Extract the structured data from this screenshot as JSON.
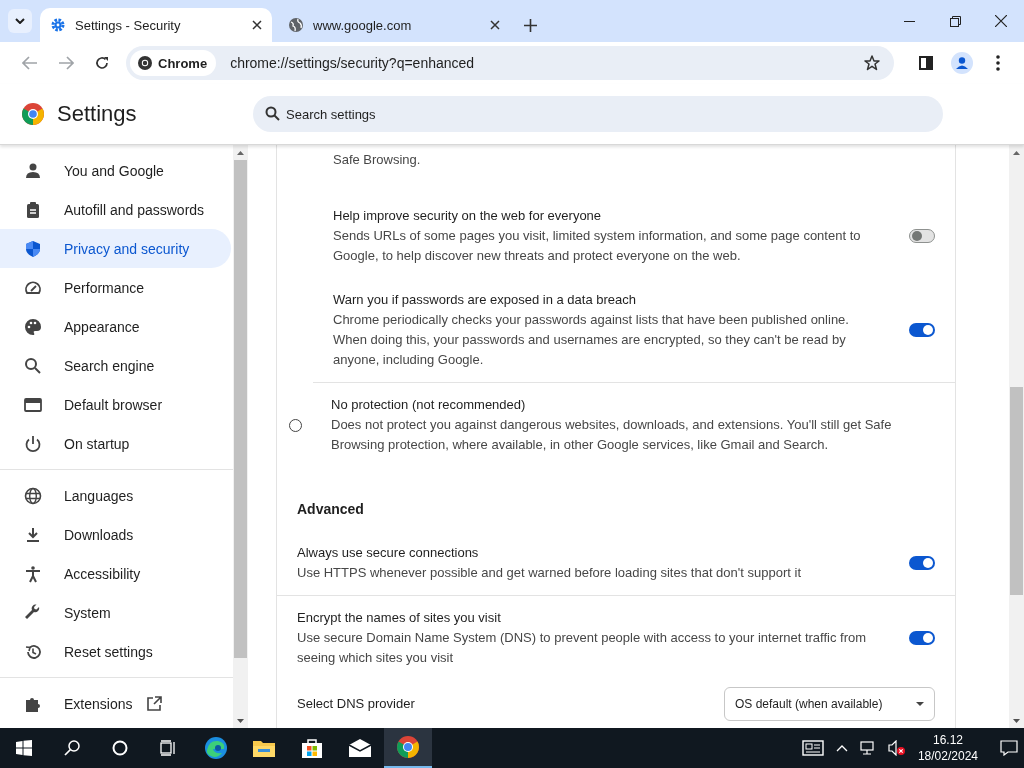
{
  "tabs": [
    {
      "title": "Settings - Security",
      "selected": true
    },
    {
      "title": "www.google.com",
      "selected": false
    }
  ],
  "toolbar": {
    "site_chip": "Chrome",
    "url": "chrome://settings/security?q=enhanced"
  },
  "header": {
    "title": "Settings",
    "search_placeholder": "Search settings"
  },
  "sidebar": {
    "groups": [
      [
        {
          "label": "You and Google",
          "selected": false
        },
        {
          "label": "Autofill and passwords",
          "selected": false
        },
        {
          "label": "Privacy and security",
          "selected": true
        },
        {
          "label": "Performance",
          "selected": false
        },
        {
          "label": "Appearance",
          "selected": false
        },
        {
          "label": "Search engine",
          "selected": false
        },
        {
          "label": "Default browser",
          "selected": false
        },
        {
          "label": "On startup",
          "selected": false
        }
      ],
      [
        {
          "label": "Languages",
          "selected": false
        },
        {
          "label": "Downloads",
          "selected": false
        },
        {
          "label": "Accessibility",
          "selected": false
        },
        {
          "label": "System",
          "selected": false
        },
        {
          "label": "Reset settings",
          "selected": false
        }
      ],
      [
        {
          "label": "Extensions",
          "selected": false,
          "external": true
        }
      ]
    ]
  },
  "content": {
    "rows": [
      {
        "kind": "note",
        "text": "Safe Browsing.",
        "separated": false
      },
      {
        "kind": "sub_toggle",
        "title": "Help improve security on the web for everyone",
        "description": "Sends URLs of some pages you visit, limited system information, and some page content to Google, to help discover new threats and protect everyone on the web.",
        "on": false,
        "separated": false
      },
      {
        "kind": "sub_toggle",
        "title": "Warn you if passwords are exposed in a data breach",
        "description": "Chrome periodically checks your passwords against lists that have been published online. When doing this, your passwords and usernames are encrypted, so they can't be read by anyone, including Google.",
        "on": true,
        "separated": true
      },
      {
        "kind": "radio",
        "title": "No protection (not recommended)",
        "description": "Does not protect you against dangerous websites, downloads, and extensions. You'll still get Safe Browsing protection, where available, in other Google services, like Gmail and Search.",
        "selected": false,
        "separated": false
      },
      {
        "kind": "heading",
        "text": "Advanced",
        "separated": false
      },
      {
        "kind": "toggle",
        "title": "Always use secure connections",
        "description": "Use HTTPS whenever possible and get warned before loading sites that don't support it",
        "on": true,
        "separated": true
      },
      {
        "kind": "toggle",
        "title": "Encrypt the names of sites you visit",
        "description": "Use secure Domain Name System (DNS) to prevent people with access to your internet traffic from seeing which sites you visit",
        "on": true,
        "separated": false
      },
      {
        "kind": "dropdown",
        "label": "Select DNS provider",
        "value": "OS default (when available)",
        "separated": false
      }
    ]
  },
  "taskbar": {
    "time": "16.12",
    "date": "18/02/2024"
  }
}
